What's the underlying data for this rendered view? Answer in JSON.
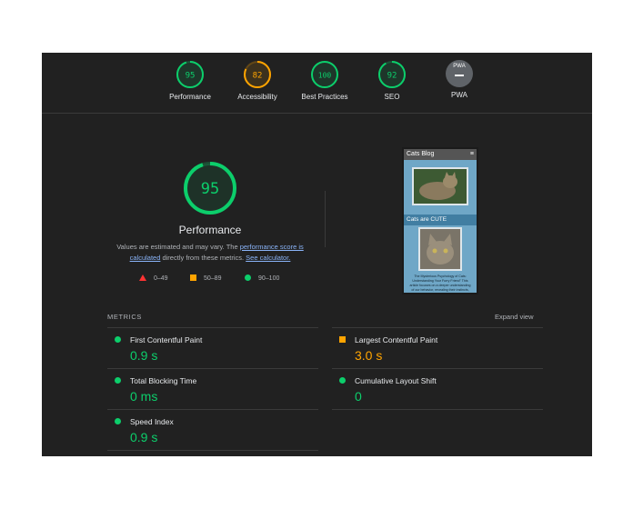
{
  "summary": {
    "gauges": [
      {
        "score": "95",
        "label": "Performance",
        "status": "pass"
      },
      {
        "score": "82",
        "label": "Accessibility",
        "status": "average"
      },
      {
        "score": "100",
        "label": "Best Practices",
        "status": "pass"
      },
      {
        "score": "92",
        "label": "SEO",
        "status": "pass"
      }
    ],
    "pwa": {
      "badge_text": "PWA",
      "label": "PWA"
    }
  },
  "performance": {
    "score": "95",
    "title": "Performance",
    "desc_pre": "Values are estimated and may vary. The ",
    "desc_link1": "performance score is calculated",
    "desc_mid": " directly from these metrics. ",
    "desc_link2": "See calculator."
  },
  "legend": {
    "fail": "0–49",
    "average": "50–89",
    "pass": "90–100"
  },
  "screenshot": {
    "title": "Cats Blog",
    "subtitle": "Cats are CUTE",
    "caption": "The Mysterious Psychology of Cats: Understanding Your Furry Friend\" This article focuses on a deeper understanding of our behavior, revealing their instincts, needs, and communication"
  },
  "metrics": {
    "heading": "METRICS",
    "expand_label": "Expand view",
    "items": [
      {
        "label": "First Contentful Paint",
        "value": "0.9 s",
        "status": "pass"
      },
      {
        "label": "Largest Contentful Paint",
        "value": "3.0 s",
        "status": "average"
      },
      {
        "label": "Total Blocking Time",
        "value": "0 ms",
        "status": "pass"
      },
      {
        "label": "Cumulative Layout Shift",
        "value": "0",
        "status": "pass"
      },
      {
        "label": "Speed Index",
        "value": "0.9 s",
        "status": "pass"
      }
    ]
  },
  "colors": {
    "pass": "#0cce6b",
    "average": "#ffa400",
    "fail": "#ff3333",
    "background": "#212121"
  }
}
